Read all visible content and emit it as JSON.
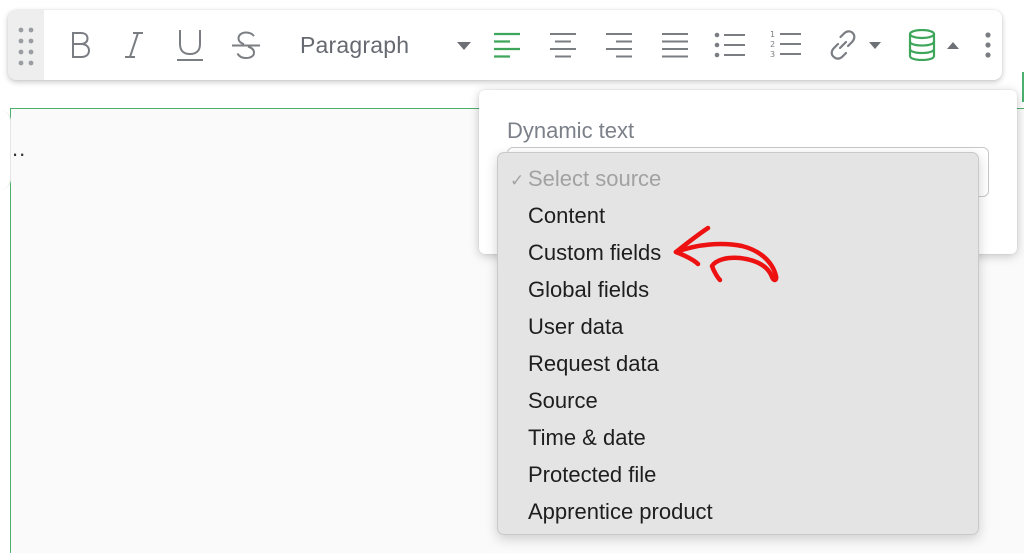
{
  "toolbar": {
    "paragraph_label": "Paragraph",
    "icons": {
      "drag": "drag-handle-icon",
      "bold": "bold-icon",
      "italic": "italic-icon",
      "underline": "underline-icon",
      "strikethrough": "strikethrough-icon",
      "align_left": "align-left-icon",
      "align_center": "align-center-icon",
      "align_right": "align-right-icon",
      "justify": "justify-icon",
      "bullet_list": "bullet-list-icon",
      "numbered_list": "numbered-list-icon",
      "link": "link-icon",
      "database": "database-icon",
      "more": "more-vertical-icon"
    },
    "accent_color": "#3ea65a",
    "icon_color": "#7a7d82"
  },
  "editor": {
    "visible_text": ".."
  },
  "popover": {
    "title": "Dynamic text"
  },
  "dropdown": {
    "placeholder": "Select source",
    "check_mark": "✓",
    "options": [
      "Content",
      "Custom fields",
      "Global fields",
      "User data",
      "Request data",
      "Source",
      "Time & date",
      "Protected file",
      "Apprentice product"
    ]
  },
  "annotation": {
    "color": "#ee1111",
    "points_to": "Custom fields"
  }
}
